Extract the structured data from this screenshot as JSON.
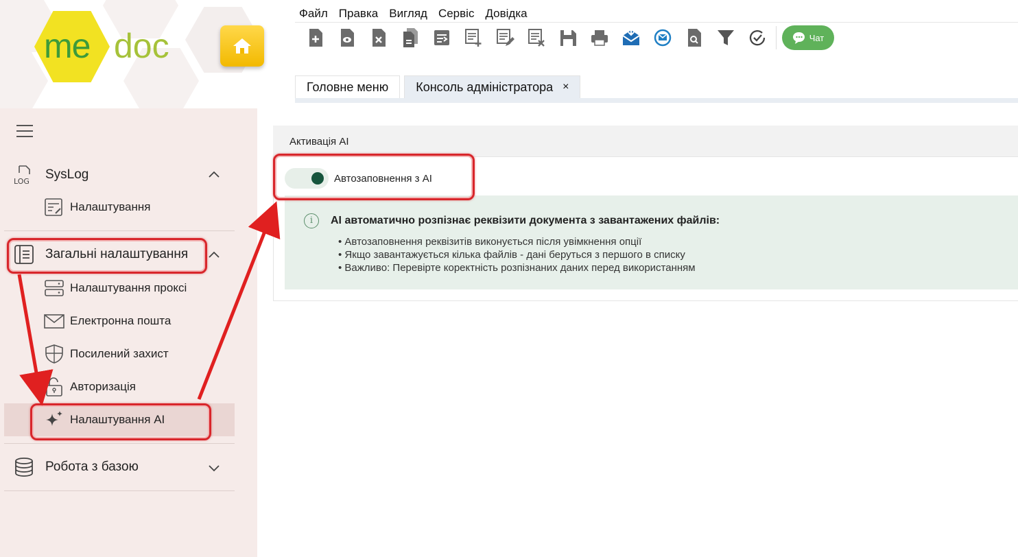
{
  "app": {
    "logo_me": "me",
    "logo_doc": "doc",
    "home_icon": "home-icon"
  },
  "menu": [
    "Файл",
    "Правка",
    "Вигляд",
    "Сервіс",
    "Довідка"
  ],
  "toolbar": {
    "icons": [
      "new-document-icon",
      "view-document-icon",
      "delete-document-icon",
      "copy-document-icon",
      "move-document-icon",
      "add-row-icon",
      "edit-row-icon",
      "delete-row-icon",
      "save-icon",
      "print-icon",
      "receive-mail-icon",
      "exchange-mail-icon",
      "search-document-icon",
      "filter-icon",
      "check-sync-icon"
    ],
    "chat_label": "Чат"
  },
  "tabs": [
    {
      "label": "Головне меню",
      "active": false
    },
    {
      "label": "Консоль адміністратора",
      "active": true,
      "close": "×"
    }
  ],
  "sidebar": {
    "groups": [
      {
        "label": "SysLog",
        "icon": "log-icon",
        "expanded": true,
        "items": [
          {
            "label": "Налаштування",
            "icon": "settings-form-icon"
          }
        ]
      },
      {
        "label": "Загальні налаштування",
        "icon": "panel-icon",
        "expanded": true,
        "items": [
          {
            "label": "Налаштування проксі",
            "icon": "server-icon"
          },
          {
            "label": "Електронна пошта",
            "icon": "mail-icon"
          },
          {
            "label": "Посилений захист",
            "icon": "shield-icon"
          },
          {
            "label": "Авторизація",
            "icon": "unlock-icon"
          },
          {
            "label": "Налаштування AI",
            "icon": "sparkle-icon",
            "selected": true
          }
        ]
      },
      {
        "label": "Робота з базою",
        "icon": "database-icon",
        "expanded": false,
        "items": []
      }
    ]
  },
  "content": {
    "section_title": "Активація AI",
    "toggle_label": "Автозаповнення з AI",
    "toggle_on": true,
    "info_title": "AI автоматично розпізнає реквізити документа з завантажених файлів:",
    "info_items": [
      "Автозаповнення реквізитів виконується після увімкнення опції",
      "Якщо завантажується кілька файлів - дані беруться з першого в списку",
      "Важливо: Перевірте коректність розпізнаних даних перед використанням"
    ]
  },
  "colors": {
    "accent_green": "#17553d",
    "chat_green": "#5fb25a",
    "highlight_red": "#d8262b",
    "sidebar_bg": "#f6ebe9"
  }
}
